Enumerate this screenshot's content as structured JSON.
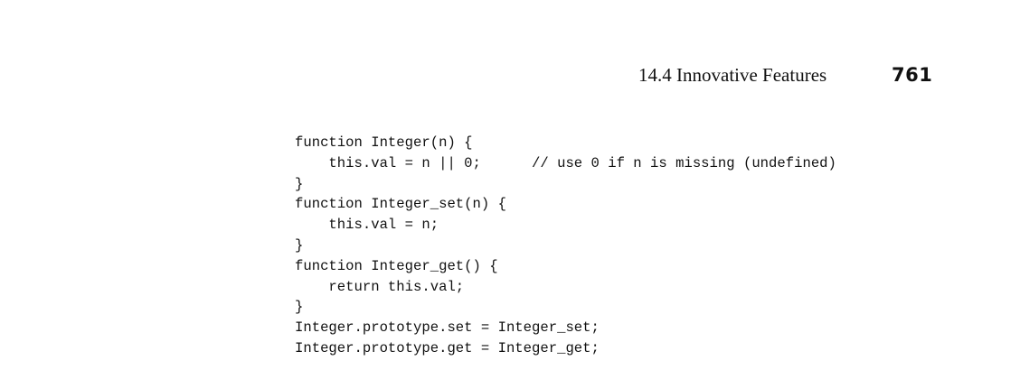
{
  "header": {
    "section_title": "14.4  Innovative Features",
    "page_number": "761"
  },
  "code": {
    "lines": [
      "function Integer(n) {",
      "    this.val = n || 0;      // use 0 if n is missing (undefined)",
      "}",
      "function Integer_set(n) {",
      "    this.val = n;",
      "}",
      "function Integer_get() {",
      "    return this.val;",
      "}",
      "Integer.prototype.set = Integer_set;",
      "Integer.prototype.get = Integer_get;"
    ]
  }
}
